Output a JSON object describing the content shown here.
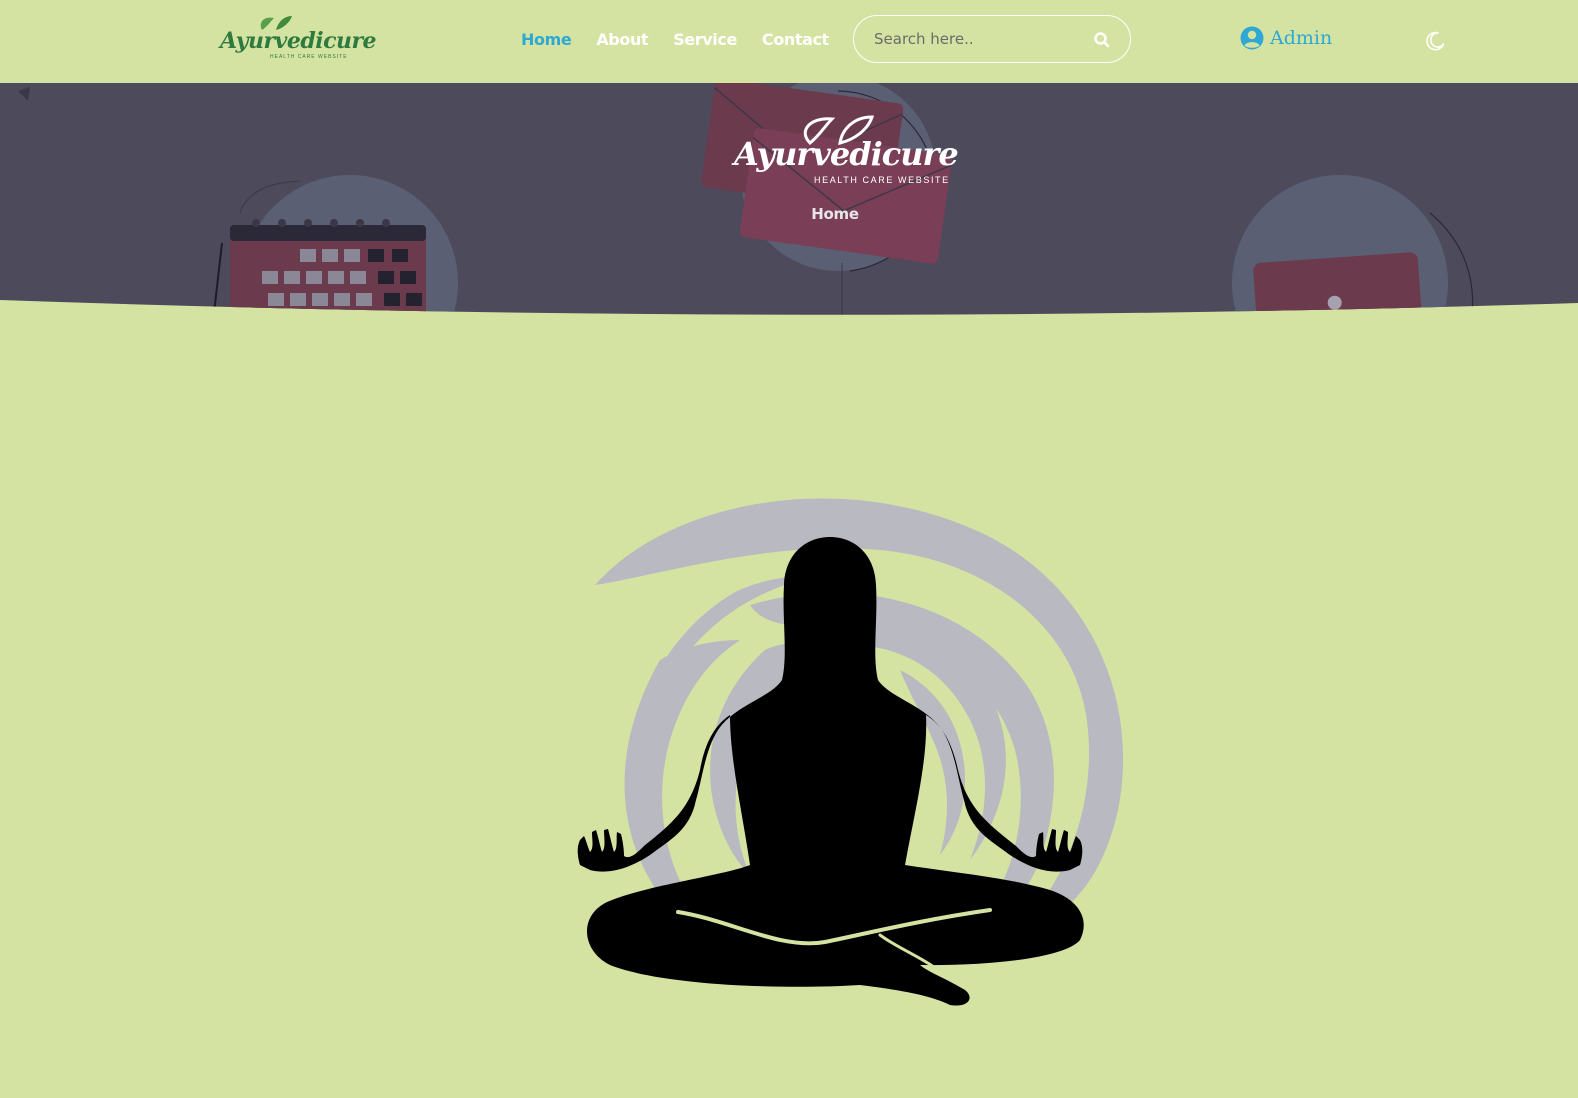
{
  "header": {
    "logo": {
      "text": "Ayurvedicure",
      "tagline": "HEALTH CARE WEBSITE"
    },
    "nav": [
      {
        "label": "Home",
        "active": true
      },
      {
        "label": "About",
        "active": false
      },
      {
        "label": "Service",
        "active": false
      },
      {
        "label": "Contact",
        "active": false
      }
    ],
    "search": {
      "placeholder": "Search here..",
      "value": "",
      "icon": "search-icon"
    },
    "admin": {
      "label": "Admin",
      "icon": "user-circle-icon"
    },
    "theme_toggle": {
      "icon": "moon-icon"
    }
  },
  "banner": {
    "logo": {
      "text": "Ayurvedicure",
      "tagline": "HEALTH CARE WEBSITE"
    },
    "breadcrumb": "Home"
  },
  "hero": {
    "image": "meditation-silhouette"
  },
  "colors": {
    "page_bg": "#d4e3a2",
    "accent": "#2fa9d3",
    "banner_bg": "#4d4a5c",
    "logo_green": "#2f7a3e",
    "swirl": "#b8b9c1",
    "silhouette": "#000000"
  }
}
